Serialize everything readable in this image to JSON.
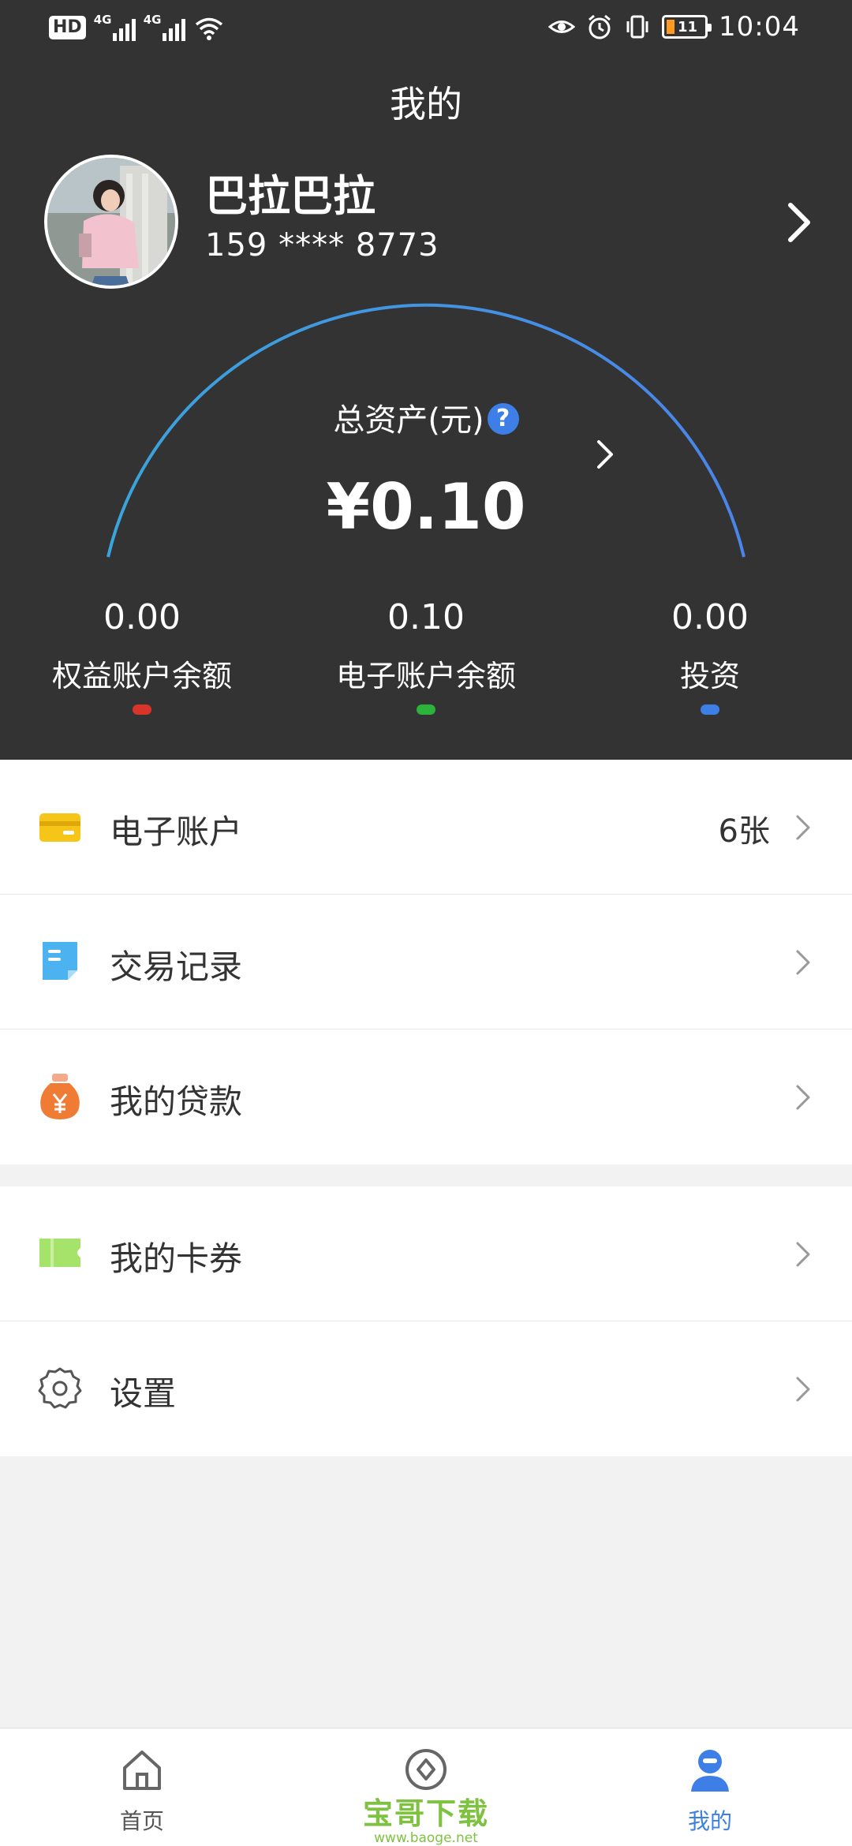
{
  "status_bar": {
    "hd_label": "HD",
    "net1": "4G",
    "net2": "4G",
    "battery_level": "11",
    "time": "10:04"
  },
  "header": {
    "title": "我的"
  },
  "profile": {
    "name": "巴拉巴拉",
    "phone": "159 **** 8773"
  },
  "assets": {
    "label": "总资产(元)",
    "help_symbol": "?",
    "total": "¥0.10",
    "arc_color": "#4a98e8"
  },
  "balances": [
    {
      "value": "0.00",
      "label": "权益账户余额",
      "color": "#d8342a"
    },
    {
      "value": "0.10",
      "label": "电子账户余额",
      "color": "#2bb33b"
    },
    {
      "value": "0.00",
      "label": "投资",
      "color": "#3d7fe6"
    }
  ],
  "menu_group_1": [
    {
      "label": "电子账户",
      "extra": "6张",
      "icon": "card-icon"
    },
    {
      "label": "交易记录",
      "extra": "",
      "icon": "record-icon"
    },
    {
      "label": "我的贷款",
      "extra": "",
      "icon": "loan-bag-icon"
    }
  ],
  "menu_group_2": [
    {
      "label": "我的卡券",
      "extra": "",
      "icon": "coupon-icon"
    },
    {
      "label": "设置",
      "extra": "",
      "icon": "settings-gear-icon"
    }
  ],
  "bottom_nav": {
    "home_label": "首页",
    "mine_label": "我的",
    "watermark_main": "宝哥下载",
    "watermark_sub": "www.baoge.net"
  },
  "colors": {
    "header_bg": "#333333",
    "accent_blue": "#3d7fe6",
    "card_yellow": "#f5c518",
    "record_blue": "#4db3f0",
    "loan_orange": "#f07b35",
    "coupon_green": "#a6e36b"
  }
}
